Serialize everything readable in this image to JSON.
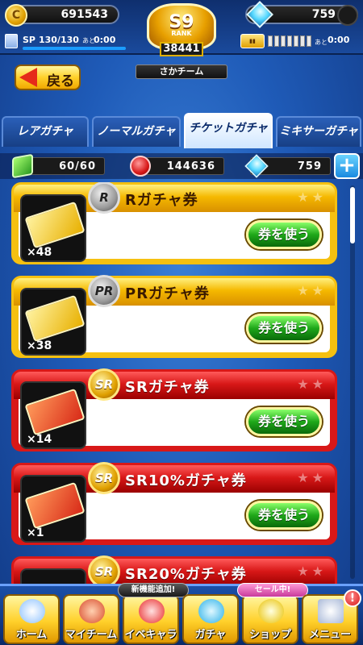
{
  "header": {
    "coins": "691543",
    "gems": "759",
    "sp_label": "SP",
    "sp_value": "130/130",
    "sp_ato": "あと",
    "sp_time": "0:00",
    "ticket_ato": "あと",
    "ticket_time": "0:00",
    "rank_letter": "S9",
    "rank_word": "RANK",
    "rank_score": "38441",
    "team_name": "さかチーム",
    "back_label": "戻る"
  },
  "tabs": [
    {
      "label": "レアガチャ"
    },
    {
      "label": "ノーマルガチャ"
    },
    {
      "label": "チケットガチャ"
    },
    {
      "label": "ミキサーガチャ"
    }
  ],
  "resources": {
    "green": "60/60",
    "red": "144636",
    "gems": "759",
    "plus": "+"
  },
  "cards": [
    {
      "badge": "R",
      "title": "Rガチャ券",
      "count": "×48",
      "button": "券を使う",
      "theme": "gold"
    },
    {
      "badge": "PR",
      "title": "PRガチャ券",
      "count": "×38",
      "button": "券を使う",
      "theme": "gold"
    },
    {
      "badge": "SR",
      "title": "SRガチャ券",
      "count": "×14",
      "button": "券を使う",
      "theme": "red"
    },
    {
      "badge": "SR",
      "title": "SR10%ガチャ券",
      "count": "×1",
      "button": "券を使う",
      "theme": "red"
    },
    {
      "badge": "SR",
      "title": "SR20%ガチャ券",
      "theme": "red"
    }
  ],
  "nav": {
    "home": "ホーム",
    "my_team": "マイチーム",
    "event_chara": "イベキャラ",
    "event_tag": "新機能追加!",
    "gacha": "ガチャ",
    "shop": "ショップ",
    "shop_tag": "セール中!",
    "menu": "メニュー",
    "menu_notice": "!"
  },
  "colors": {
    "gold_card": "#f5c010",
    "red_card": "#d81818",
    "use_button": "#1fa81a"
  }
}
